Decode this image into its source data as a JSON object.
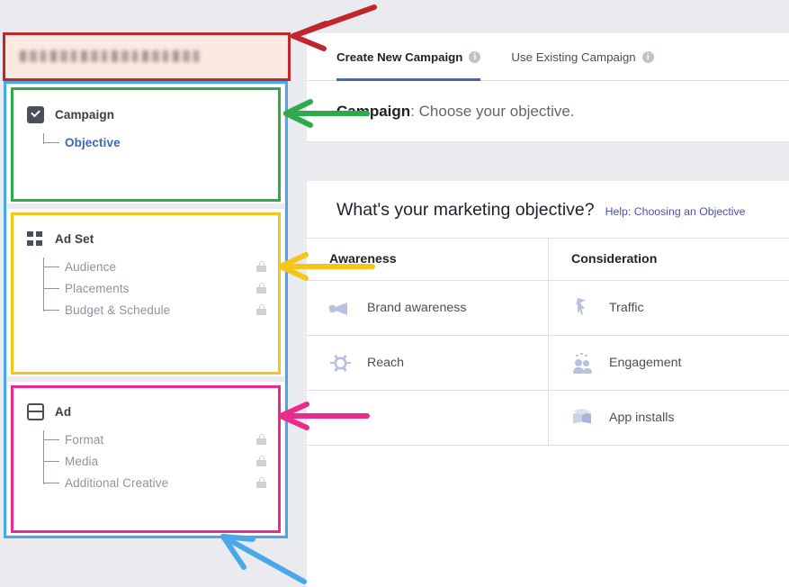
{
  "account_bar": {
    "redacted_text": "███████████████",
    "note": "blurred account name"
  },
  "sidebar": {
    "sections": [
      {
        "id": "campaign",
        "title": "Campaign",
        "icon": "checkbox-checked-icon",
        "items": [
          {
            "label": "Objective",
            "active": true,
            "locked": false
          }
        ]
      },
      {
        "id": "ad-set",
        "title": "Ad Set",
        "icon": "grid-icon",
        "items": [
          {
            "label": "Audience",
            "active": false,
            "locked": true
          },
          {
            "label": "Placements",
            "active": false,
            "locked": true
          },
          {
            "label": "Budget & Schedule",
            "active": false,
            "locked": true
          }
        ]
      },
      {
        "id": "ad",
        "title": "Ad",
        "icon": "ad-window-icon",
        "items": [
          {
            "label": "Format",
            "active": false,
            "locked": true
          },
          {
            "label": "Media",
            "active": false,
            "locked": true
          },
          {
            "label": "Additional Creative",
            "active": false,
            "locked": true
          }
        ]
      }
    ]
  },
  "content": {
    "tabs": [
      {
        "label": "Create New Campaign",
        "selected": true,
        "info": "i"
      },
      {
        "label": "Use Existing Campaign",
        "selected": false,
        "info": "i"
      }
    ],
    "step_header": {
      "bold": "Campaign",
      "rest": ": Choose your objective."
    },
    "objective_question": "What's your marketing objective?",
    "help_link": "Help: Choosing an Objective",
    "columns": [
      {
        "header": "Awareness",
        "objectives": [
          {
            "label": "Brand awareness",
            "icon": "megaphone-icon"
          },
          {
            "label": "Reach",
            "icon": "burst-icon"
          },
          {
            "label": "",
            "icon": ""
          }
        ]
      },
      {
        "header": "Consideration",
        "objectives": [
          {
            "label": "Traffic",
            "icon": "cursor-icon"
          },
          {
            "label": "Engagement",
            "icon": "people-icon"
          },
          {
            "label": "App installs",
            "icon": "box-icon"
          }
        ]
      }
    ]
  },
  "annotations": {
    "colors": {
      "red": "#c0272d",
      "blue": "#4aa8e8",
      "green": "#2faa4a",
      "yellow": "#f5c518",
      "pink": "#ea2a8c"
    },
    "boxes": [
      {
        "color": "red",
        "target": "account-bar"
      },
      {
        "color": "blue",
        "target": "full-navigation-rail"
      },
      {
        "color": "green",
        "target": "campaign-section"
      },
      {
        "color": "yellow",
        "target": "ad-set-section"
      },
      {
        "color": "pink",
        "target": "ad-section"
      }
    ],
    "arrows": [
      {
        "color": "red",
        "points_to": "account-bar"
      },
      {
        "color": "green",
        "points_to": "campaign-section"
      },
      {
        "color": "yellow",
        "points_to": "ad-set-section"
      },
      {
        "color": "pink",
        "points_to": "ad-section"
      },
      {
        "color": "blue",
        "points_to": "full-navigation-rail"
      }
    ]
  },
  "theme": {
    "accent_blue": "#4267b2",
    "page_bg": "#e9ebee",
    "panel_bg": "#ffffff",
    "icon_lavender": "#b9c0e0",
    "muted_text": "#8d949e"
  }
}
